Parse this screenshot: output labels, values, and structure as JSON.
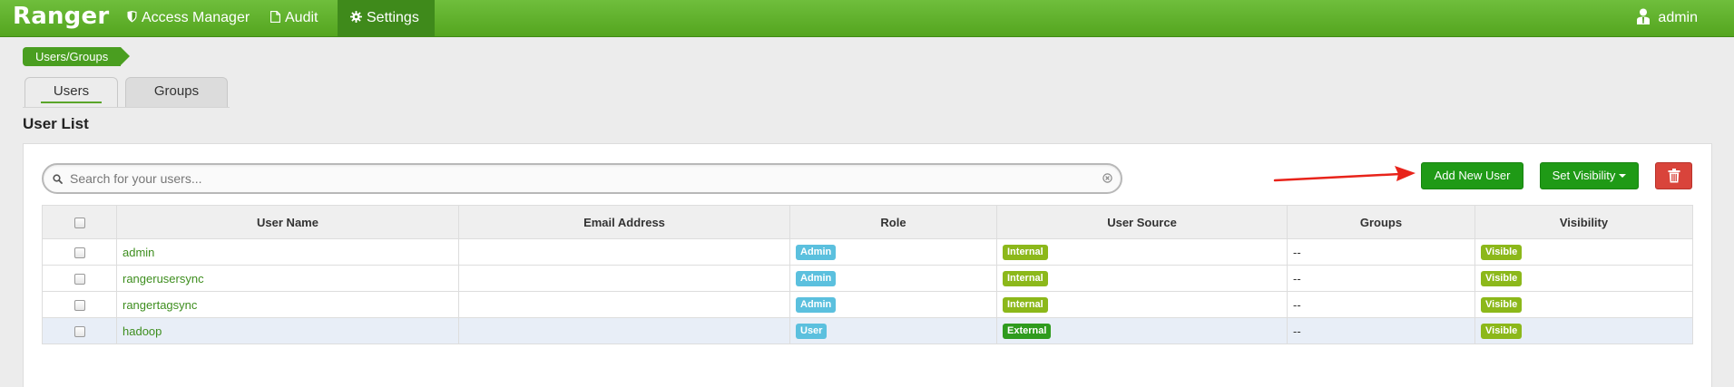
{
  "app": {
    "brand": "Ranger"
  },
  "nav": {
    "items": [
      {
        "label": "Access Manager",
        "icon": "shield-icon"
      },
      {
        "label": "Audit",
        "icon": "file-icon"
      },
      {
        "label": "Settings",
        "icon": "gear-icon",
        "active": true
      }
    ],
    "user": {
      "label": "admin",
      "icon": "user-icon"
    }
  },
  "breadcrumb": {
    "label": "Users/Groups"
  },
  "tabs": [
    {
      "label": "Users",
      "active": true
    },
    {
      "label": "Groups",
      "active": false
    }
  ],
  "section_title": "User List",
  "search": {
    "placeholder": "Search for your users...",
    "value": ""
  },
  "toolbar": {
    "add_label": "Add New User",
    "visibility_label": "Set Visibility",
    "delete_icon": "trash-icon"
  },
  "table": {
    "columns": [
      "User Name",
      "Email Address",
      "Role",
      "User Source",
      "Groups",
      "Visibility"
    ],
    "rows": [
      {
        "name": "admin",
        "email": "",
        "role": "Admin",
        "source": "Internal",
        "groups": "--",
        "visibility": "Visible"
      },
      {
        "name": "rangerusersync",
        "email": "",
        "role": "Admin",
        "source": "Internal",
        "groups": "--",
        "visibility": "Visible"
      },
      {
        "name": "rangertagsync",
        "email": "",
        "role": "Admin",
        "source": "Internal",
        "groups": "--",
        "visibility": "Visible"
      },
      {
        "name": "hadoop",
        "email": "",
        "role": "User",
        "source": "External",
        "groups": "--",
        "visibility": "Visible"
      }
    ]
  },
  "colors": {
    "nav_green": "#5cad28",
    "button_green": "#1f9a16",
    "danger_red": "#d9443b",
    "role_badge": "#5bc0de",
    "internal_badge": "#8cb81a",
    "external_badge": "#2f9b1e",
    "annotation_arrow": "#e8231a"
  }
}
